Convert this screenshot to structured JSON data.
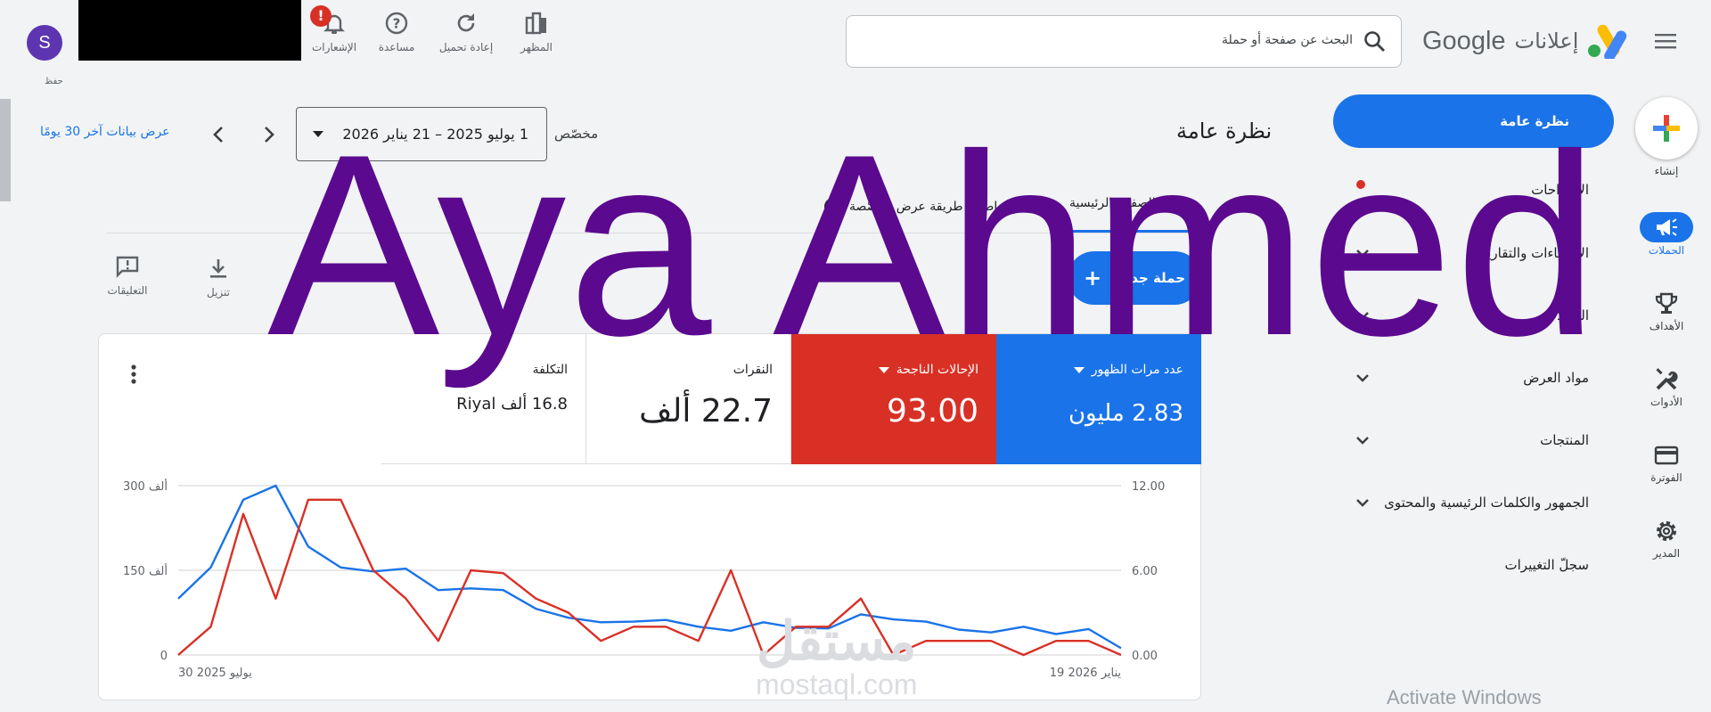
{
  "header": {
    "brand_google": "Google",
    "brand_ads": "إعلانات",
    "search_placeholder": "البحث عن صفحة أو حملة",
    "tools": [
      {
        "label": "المظهر",
        "icon": "appearance-icon"
      },
      {
        "label": "إعادة تحميل",
        "icon": "refresh-icon"
      },
      {
        "label": "مساعدة",
        "icon": "help-icon"
      },
      {
        "label": "الإشعارات",
        "icon": "bell-icon"
      }
    ],
    "notification_badge": "!",
    "avatar_initial": "S",
    "avatar_caption": "حفظ"
  },
  "rail": {
    "create": "إنشاء",
    "items": [
      {
        "label": "الحملات",
        "icon": "campaigns-icon",
        "active": true
      },
      {
        "label": "الأهداف",
        "icon": "trophy-icon"
      },
      {
        "label": "الأدوات",
        "icon": "tools-icon"
      },
      {
        "label": "الفوترة",
        "icon": "billing-icon"
      },
      {
        "label": "المدير",
        "icon": "gear-icon"
      }
    ]
  },
  "sidenav": {
    "active": "نظرة عامة",
    "items": [
      {
        "label": "الاقتراحات",
        "has_chevron": false
      },
      {
        "label": "الإحصاءات والتقارير",
        "has_chevron": true
      },
      {
        "label": "الحملات",
        "has_chevron": true
      },
      {
        "label": "مواد العرض",
        "has_chevron": true
      },
      {
        "label": "المنتجات",
        "has_chevron": true
      },
      {
        "label": "الجمهور والكلمات الرئيسية والمحتوى",
        "has_chevron": true
      },
      {
        "label": "سجلّ التغييرات",
        "has_chevron": false
      }
    ]
  },
  "main": {
    "title": "نظرة عامة",
    "custom_label": "مخصّص",
    "date_range": "1 يوليو 2025 – 21 يناير 2026",
    "last_30": "عرض بيانات آخر 30 يومًا",
    "tab_home": "الصفحة الرئيسية",
    "add_view": "إضافة طريقة عرض مخصّصة",
    "new_campaign": "حملة جديدة",
    "actions": [
      {
        "label": "تنزيل",
        "icon": "download-icon"
      },
      {
        "label": "التعليقات",
        "icon": "feedback-icon"
      }
    ]
  },
  "metrics": [
    {
      "name": "عدد مرات الظهور",
      "value": "2.83 مليون",
      "color": "#1a73e8"
    },
    {
      "name": "الإحالات الناجحة",
      "value": "93.00",
      "color": "#d93025"
    },
    {
      "name": "النقرات",
      "value": "22.7 ألف"
    },
    {
      "name": "التكلفة",
      "value": "16.8 ألف Riyal"
    }
  ],
  "chart_data": {
    "type": "line",
    "x_start_label": "30 يوليو 2025",
    "x_end_label": "19 يناير 2026",
    "y_left_ticks": [
      "300 ألف",
      "150 ألف",
      "0"
    ],
    "y_right_ticks": [
      "12.00",
      "6.00",
      "0.00"
    ],
    "y_left_range": [
      0,
      300000
    ],
    "y_right_range": [
      0,
      12
    ],
    "series": [
      {
        "name": "عدد مرات الظهور",
        "axis": "left",
        "color": "#1a73e8",
        "values": [
          100000,
          155000,
          275000,
          300000,
          192000,
          155000,
          148000,
          153000,
          115000,
          118000,
          115000,
          82000,
          66000,
          58000,
          59000,
          62000,
          50000,
          43000,
          58000,
          48000,
          47000,
          72000,
          63000,
          59000,
          45000,
          40000,
          50000,
          37000,
          46000,
          12000
        ]
      },
      {
        "name": "الإحالات الناجحة",
        "axis": "right",
        "color": "#d93025",
        "values": [
          0,
          2,
          10,
          4,
          11,
          11,
          6,
          4,
          1,
          6,
          5.8,
          4,
          3,
          1,
          2,
          2,
          1,
          6,
          0,
          2,
          2,
          4,
          0,
          1,
          1,
          1,
          0,
          1,
          1,
          0
        ]
      }
    ]
  },
  "overlays": {
    "watermark_text": "Aya Ahmed",
    "mostaql_ar": "مستقل",
    "mostaql_en": "mostaql.com",
    "activate_windows": "Activate Windows"
  }
}
